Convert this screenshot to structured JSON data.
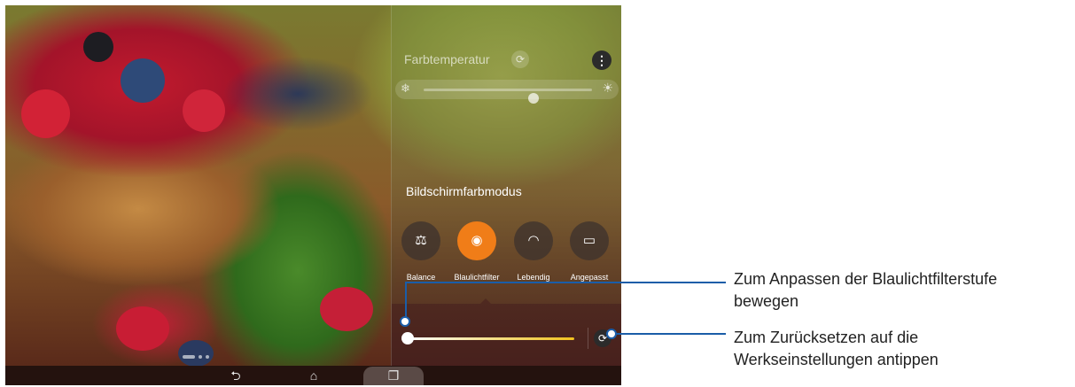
{
  "color_temperature": {
    "title": "Farbtemperatur",
    "reset_icon": "refresh-icon",
    "menu_icon": "more-vertical-icon",
    "cold_icon": "snowflake-icon",
    "warm_icon": "sun-icon",
    "level": 0.65
  },
  "screen_color_mode": {
    "title": "Bildschirmfarbmodus",
    "modes": [
      {
        "label": "Balance",
        "icon": "scales-icon",
        "glyph": "⚖",
        "active": false
      },
      {
        "label": "Blaulichtfilter",
        "icon": "eye-shield-icon",
        "glyph": "◉",
        "active": true
      },
      {
        "label": "Lebendig",
        "icon": "signal-arcs-icon",
        "glyph": "◠",
        "active": false
      },
      {
        "label": "Angepasst",
        "icon": "screen-settings-icon",
        "glyph": "▭",
        "active": false
      }
    ]
  },
  "blue_light_filter": {
    "level": 0.0,
    "reset_icon": "refresh-icon",
    "accent": "#f1c21e"
  },
  "navigation": {
    "back_glyph": "⮌",
    "home_glyph": "⌂",
    "recent_glyph": "❐"
  },
  "page_indicator": {
    "pages": 3,
    "current": 1
  },
  "callouts": [
    {
      "text_line1": "Zum Anpassen der Blaulichtfilterstufe",
      "text_line2": "bewegen"
    },
    {
      "text_line1": "Zum Zurücksetzen auf die",
      "text_line2": "Werkseinstellungen antippen"
    }
  ],
  "colors": {
    "accent_orange": "#f07d18",
    "callout_blue": "#1a5da8"
  }
}
